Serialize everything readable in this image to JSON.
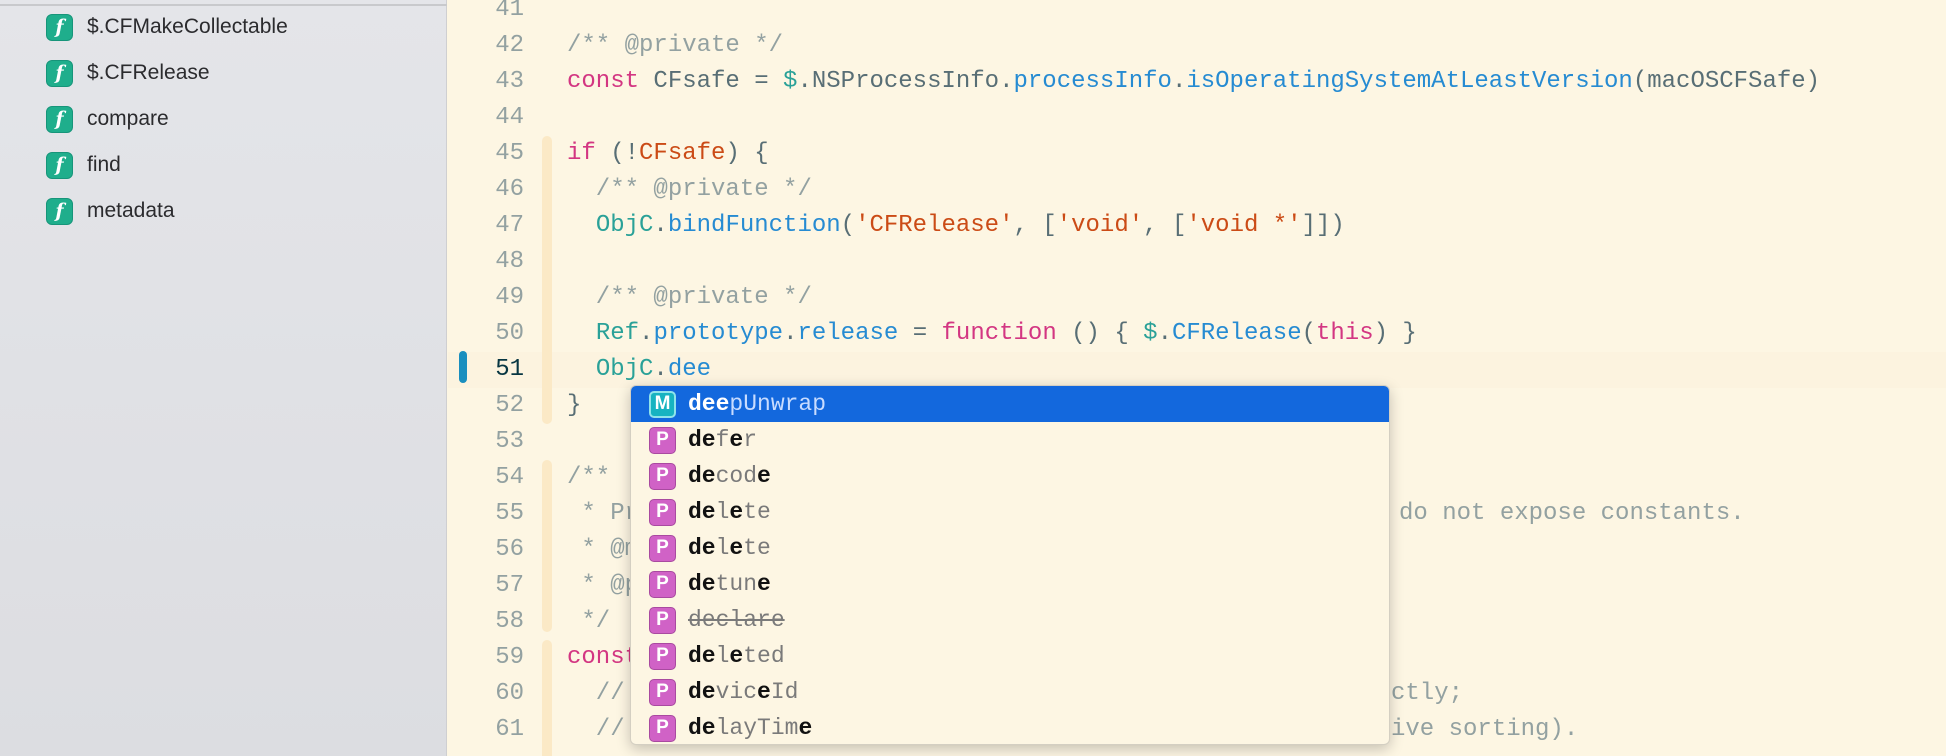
{
  "sidebar": {
    "items": [
      {
        "icon": "function-icon",
        "glyph": "f",
        "label": "$.CFMakeCollectable"
      },
      {
        "icon": "function-icon",
        "glyph": "f",
        "label": "$.CFRelease"
      },
      {
        "icon": "function-icon",
        "glyph": "f",
        "label": "compare"
      },
      {
        "icon": "function-icon",
        "glyph": "f",
        "label": "find"
      },
      {
        "icon": "function-icon",
        "glyph": "f",
        "label": "metadata"
      }
    ]
  },
  "editor": {
    "current_line": 51,
    "lines": [
      {
        "n": "41",
        "tokens": []
      },
      {
        "n": "42",
        "tokens": [
          [
            "c",
            "/** @private */"
          ]
        ]
      },
      {
        "n": "43",
        "tokens": [
          [
            "k",
            "const"
          ],
          [
            "p",
            " CFsafe = "
          ],
          [
            "t",
            "$"
          ],
          [
            "p",
            ".NSProcessInfo."
          ],
          [
            "b",
            "processInfo"
          ],
          [
            "p",
            "."
          ],
          [
            "b",
            "isOperatingSystemAtLeastVersion"
          ],
          [
            "p",
            "(macOSCFSafe)"
          ]
        ]
      },
      {
        "n": "44",
        "tokens": []
      },
      {
        "n": "45",
        "tokens": [
          [
            "k",
            "if"
          ],
          [
            "p",
            " (!"
          ],
          [
            "s",
            "CFsafe"
          ],
          [
            "p",
            ") {"
          ]
        ]
      },
      {
        "n": "46",
        "tokens": [
          [
            "c",
            "  /** @private */"
          ]
        ]
      },
      {
        "n": "47",
        "tokens": [
          [
            "p",
            "  "
          ],
          [
            "t",
            "ObjC"
          ],
          [
            "p",
            "."
          ],
          [
            "b",
            "bindFunction"
          ],
          [
            "p",
            "("
          ],
          [
            "s",
            "'CFRelease'"
          ],
          [
            "p",
            ", ["
          ],
          [
            "s",
            "'void'"
          ],
          [
            "p",
            ", ["
          ],
          [
            "s",
            "'void *'"
          ],
          [
            "p",
            "]])"
          ]
        ]
      },
      {
        "n": "48",
        "tokens": []
      },
      {
        "n": "49",
        "tokens": [
          [
            "c",
            "  /** @private */"
          ]
        ]
      },
      {
        "n": "50",
        "tokens": [
          [
            "p",
            "  "
          ],
          [
            "t",
            "Ref"
          ],
          [
            "p",
            "."
          ],
          [
            "b",
            "prototype"
          ],
          [
            "p",
            "."
          ],
          [
            "b",
            "release"
          ],
          [
            "p",
            " = "
          ],
          [
            "k",
            "function"
          ],
          [
            "p",
            " () { "
          ],
          [
            "t",
            "$"
          ],
          [
            "p",
            "."
          ],
          [
            "b",
            "CFRelease"
          ],
          [
            "p",
            "("
          ],
          [
            "k",
            "this"
          ],
          [
            "p",
            ") }"
          ]
        ]
      },
      {
        "n": "51",
        "tokens": [
          [
            "p",
            "  "
          ],
          [
            "t",
            "ObjC"
          ],
          [
            "p",
            "."
          ],
          [
            "b",
            "dee"
          ]
        ]
      },
      {
        "n": "52",
        "tokens": [
          [
            "p",
            "}"
          ]
        ]
      },
      {
        "n": "53",
        "tokens": []
      },
      {
        "n": "54",
        "tokens": [
          [
            "c",
            "/**"
          ]
        ]
      },
      {
        "n": "55",
        "tokens": [
          [
            "c",
            " * Pr"
          ]
        ],
        "tail": "do not expose constants."
      },
      {
        "n": "56",
        "tokens": [
          [
            "c",
            " * @m"
          ]
        ]
      },
      {
        "n": "57",
        "tokens": [
          [
            "c",
            " * @p"
          ]
        ]
      },
      {
        "n": "58",
        "tokens": [
          [
            "c",
            " */"
          ]
        ]
      },
      {
        "n": "59",
        "tokens": [
          [
            "k",
            "const"
          ]
        ]
      },
      {
        "n": "60",
        "tokens": [
          [
            "c",
            "  // "
          ]
        ],
        "tail": "ctly;"
      },
      {
        "n": "61",
        "tokens": [
          [
            "c",
            "  // "
          ]
        ],
        "tail": "ive sorting)."
      }
    ]
  },
  "autocomplete": {
    "selected_index": 0,
    "items": [
      {
        "kind": "M",
        "name": "deepUnwrap",
        "parts": [
          [
            "m",
            "dee"
          ],
          [
            "",
            "pUnwrap"
          ]
        ]
      },
      {
        "kind": "P",
        "name": "defer",
        "parts": [
          [
            "m",
            "de"
          ],
          [
            "",
            "f"
          ],
          [
            "m",
            "e"
          ],
          [
            "",
            "r"
          ]
        ]
      },
      {
        "kind": "P",
        "name": "decode",
        "parts": [
          [
            "m",
            "de"
          ],
          [
            "",
            "cod"
          ],
          [
            "m",
            "e"
          ]
        ]
      },
      {
        "kind": "P",
        "name": "delete",
        "parts": [
          [
            "m",
            "de"
          ],
          [
            "",
            "l"
          ],
          [
            "m",
            "e"
          ],
          [
            "",
            "te"
          ]
        ]
      },
      {
        "kind": "P",
        "name": "delete",
        "parts": [
          [
            "m",
            "de"
          ],
          [
            "",
            "l"
          ],
          [
            "m",
            "e"
          ],
          [
            "",
            "te"
          ]
        ]
      },
      {
        "kind": "P",
        "name": "detune",
        "parts": [
          [
            "m",
            "de"
          ],
          [
            "",
            "tun"
          ],
          [
            "m",
            "e"
          ]
        ]
      },
      {
        "kind": "P",
        "name": "declare",
        "deprecated": true,
        "parts": [
          [
            "",
            "declare"
          ]
        ]
      },
      {
        "kind": "P",
        "name": "deleted",
        "parts": [
          [
            "m",
            "de"
          ],
          [
            "",
            "l"
          ],
          [
            "m",
            "e"
          ],
          [
            "",
            "ted"
          ]
        ]
      },
      {
        "kind": "P",
        "name": "deviceId",
        "parts": [
          [
            "m",
            "de"
          ],
          [
            "",
            "vic"
          ],
          [
            "m",
            "e"
          ],
          [
            "",
            "Id"
          ]
        ]
      },
      {
        "kind": "P",
        "name": "delayTime",
        "parts": [
          [
            "m",
            "de"
          ],
          [
            "",
            "layTim"
          ],
          [
            "m",
            "e"
          ]
        ]
      }
    ]
  }
}
